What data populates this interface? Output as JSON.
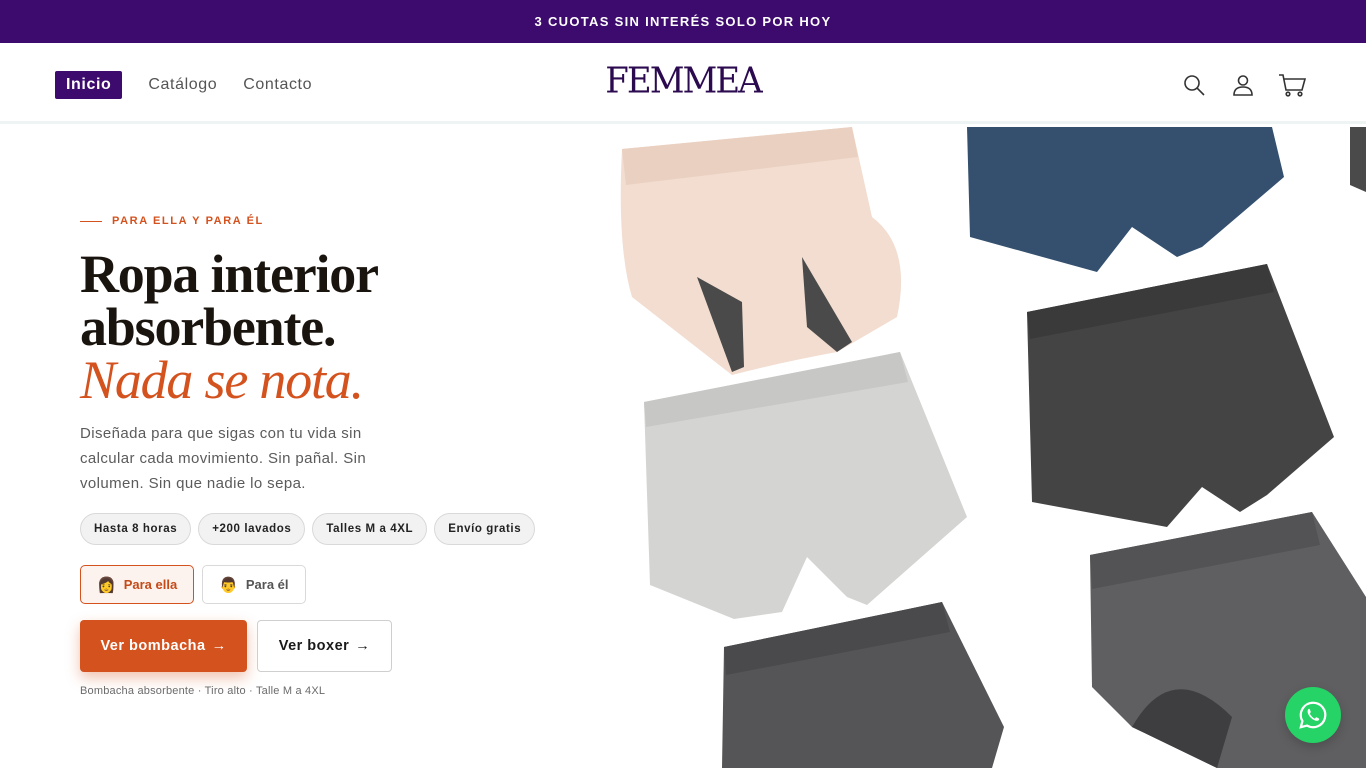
{
  "announcement": {
    "text": "3 CUOTAS SIN INTERÉS SOLO POR HOY"
  },
  "header": {
    "nav": [
      {
        "label": "Inicio",
        "active": true
      },
      {
        "label": "Catálogo",
        "active": false
      },
      {
        "label": "Contacto",
        "active": false
      }
    ],
    "logo": "FEMMEA",
    "icons": [
      "search-icon",
      "account-icon",
      "cart-icon"
    ]
  },
  "hero": {
    "eyebrow": "PARA ELLA Y PARA ÉL",
    "title_line1": "Ropa interior",
    "title_line2": "absorbente.",
    "title_accent": "Nada se nota.",
    "description": "Diseñada para que sigas con tu vida sin calcular cada movimiento. Sin pañal. Sin volumen. Sin que nadie lo sepa.",
    "chips": [
      "Hasta 8 horas",
      "+200 lavados",
      "Talles M a 4XL",
      "Envío gratis"
    ],
    "toggle": [
      {
        "emoji": "👩",
        "label": "Para ella",
        "active": true
      },
      {
        "emoji": "👨",
        "label": "Para él",
        "active": false
      }
    ],
    "cta_primary": "Ver bombacha",
    "cta_secondary": "Ver boxer",
    "cta_arrow": "→",
    "note": "Bombacha absorbente · Tiro alto · Talle M a 4XL"
  },
  "colors": {
    "brand": "#3d0a6e",
    "accent": "#d4521e",
    "whatsapp": "#25d366"
  },
  "floating": {
    "whatsapp": "whatsapp-icon"
  }
}
